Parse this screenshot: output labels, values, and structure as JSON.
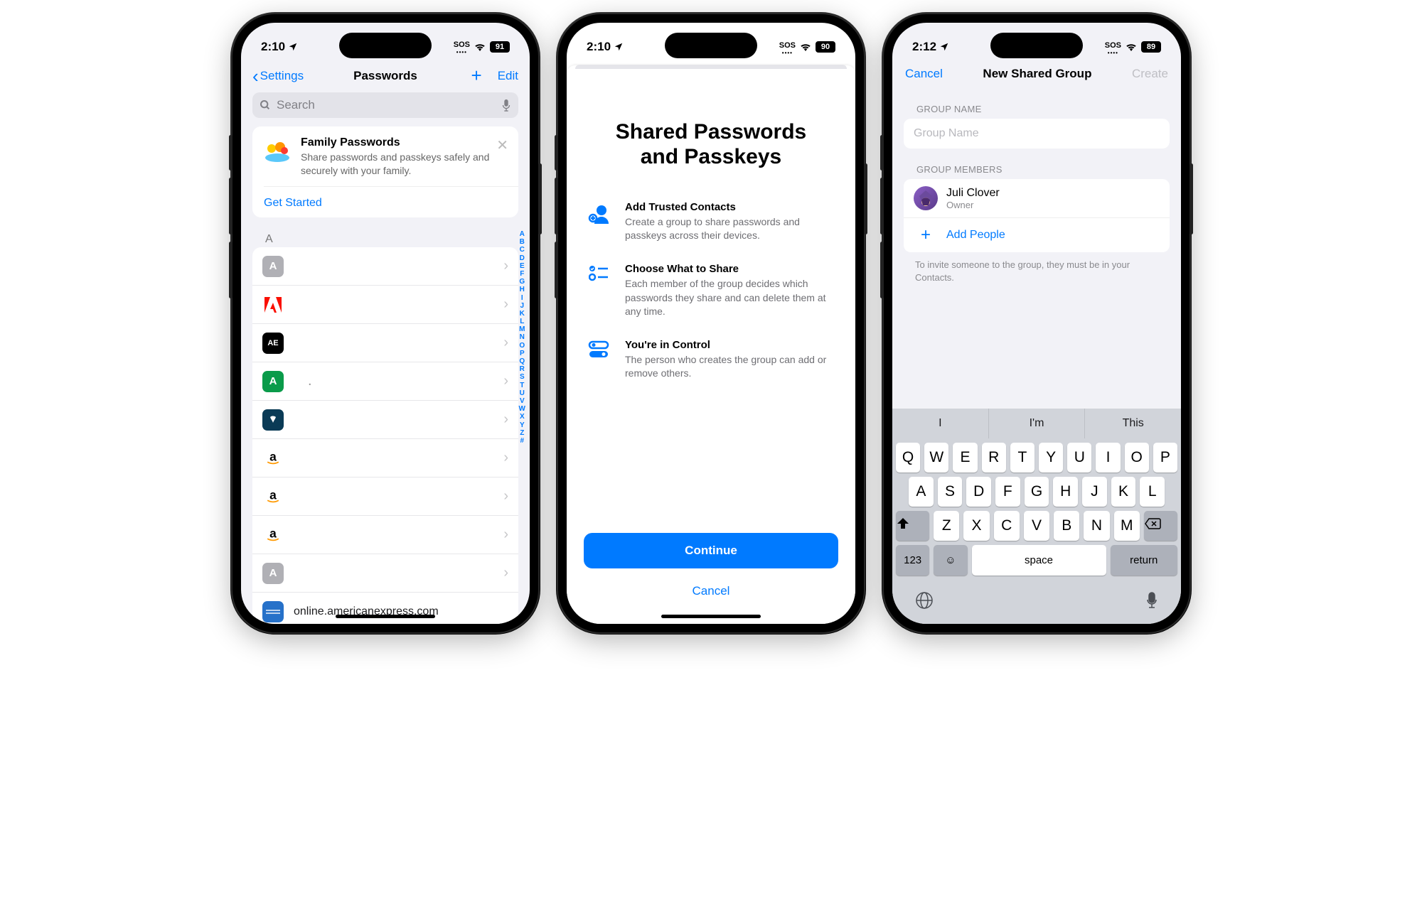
{
  "statusbar": {
    "time1": "2:10",
    "time2": "2:10",
    "time3": "2:12",
    "sos": "SOS",
    "battery1": "91",
    "battery2": "90",
    "battery3": "89"
  },
  "phone1": {
    "back": "Settings",
    "title": "Passwords",
    "edit": "Edit",
    "search_placeholder": "Search",
    "card": {
      "title": "Family Passwords",
      "desc": "Share passwords and passkeys safely and securely with your family.",
      "cta": "Get Started"
    },
    "section": "A",
    "rows": [
      {
        "label": "",
        "bg": "#b0b0b5",
        "glyph": "A"
      },
      {
        "label": "",
        "bg": "#ffffff",
        "glyph": ""
      },
      {
        "label": "",
        "bg": "#000000",
        "glyph": "AE"
      },
      {
        "label": "",
        "bg": "#0a9b4a",
        "glyph": "A"
      },
      {
        "label": "",
        "bg": "#0a3b56",
        "glyph": ""
      },
      {
        "label": "",
        "bg": "#ffffff",
        "glyph": ""
      },
      {
        "label": "",
        "bg": "#ffffff",
        "glyph": ""
      },
      {
        "label": "",
        "bg": "#ffffff",
        "glyph": ""
      },
      {
        "label": "",
        "bg": "#b0b0b5",
        "glyph": "A"
      },
      {
        "label": "online.americanexpress.com",
        "bg": "#2671c9",
        "glyph": ""
      }
    ],
    "index": [
      "A",
      "B",
      "C",
      "D",
      "E",
      "F",
      "G",
      "H",
      "I",
      "J",
      "K",
      "L",
      "M",
      "N",
      "O",
      "P",
      "Q",
      "R",
      "S",
      "T",
      "U",
      "V",
      "W",
      "X",
      "Y",
      "Z",
      "#"
    ]
  },
  "phone2": {
    "title": "Shared Passwords and Passkeys",
    "features": [
      {
        "title": "Add Trusted Contacts",
        "desc": "Create a group to share passwords and passkeys across their devices."
      },
      {
        "title": "Choose What to Share",
        "desc": "Each member of the group decides which passwords they share and can delete them at any time."
      },
      {
        "title": "You're in Control",
        "desc": "The person who creates the group can add or remove others."
      }
    ],
    "continue": "Continue",
    "cancel": "Cancel"
  },
  "phone3": {
    "cancel": "Cancel",
    "title": "New Shared Group",
    "create": "Create",
    "group_name_label": "GROUP NAME",
    "placeholder": "Group Name",
    "members_label": "GROUP MEMBERS",
    "member": {
      "name": "Juli Clover",
      "role": "Owner"
    },
    "add_people": "Add People",
    "hint": "To invite someone to the group, they must be in your Contacts.",
    "suggestions": [
      "I",
      "I'm",
      "This"
    ],
    "key_123": "123",
    "key_space": "space",
    "key_return": "return"
  }
}
